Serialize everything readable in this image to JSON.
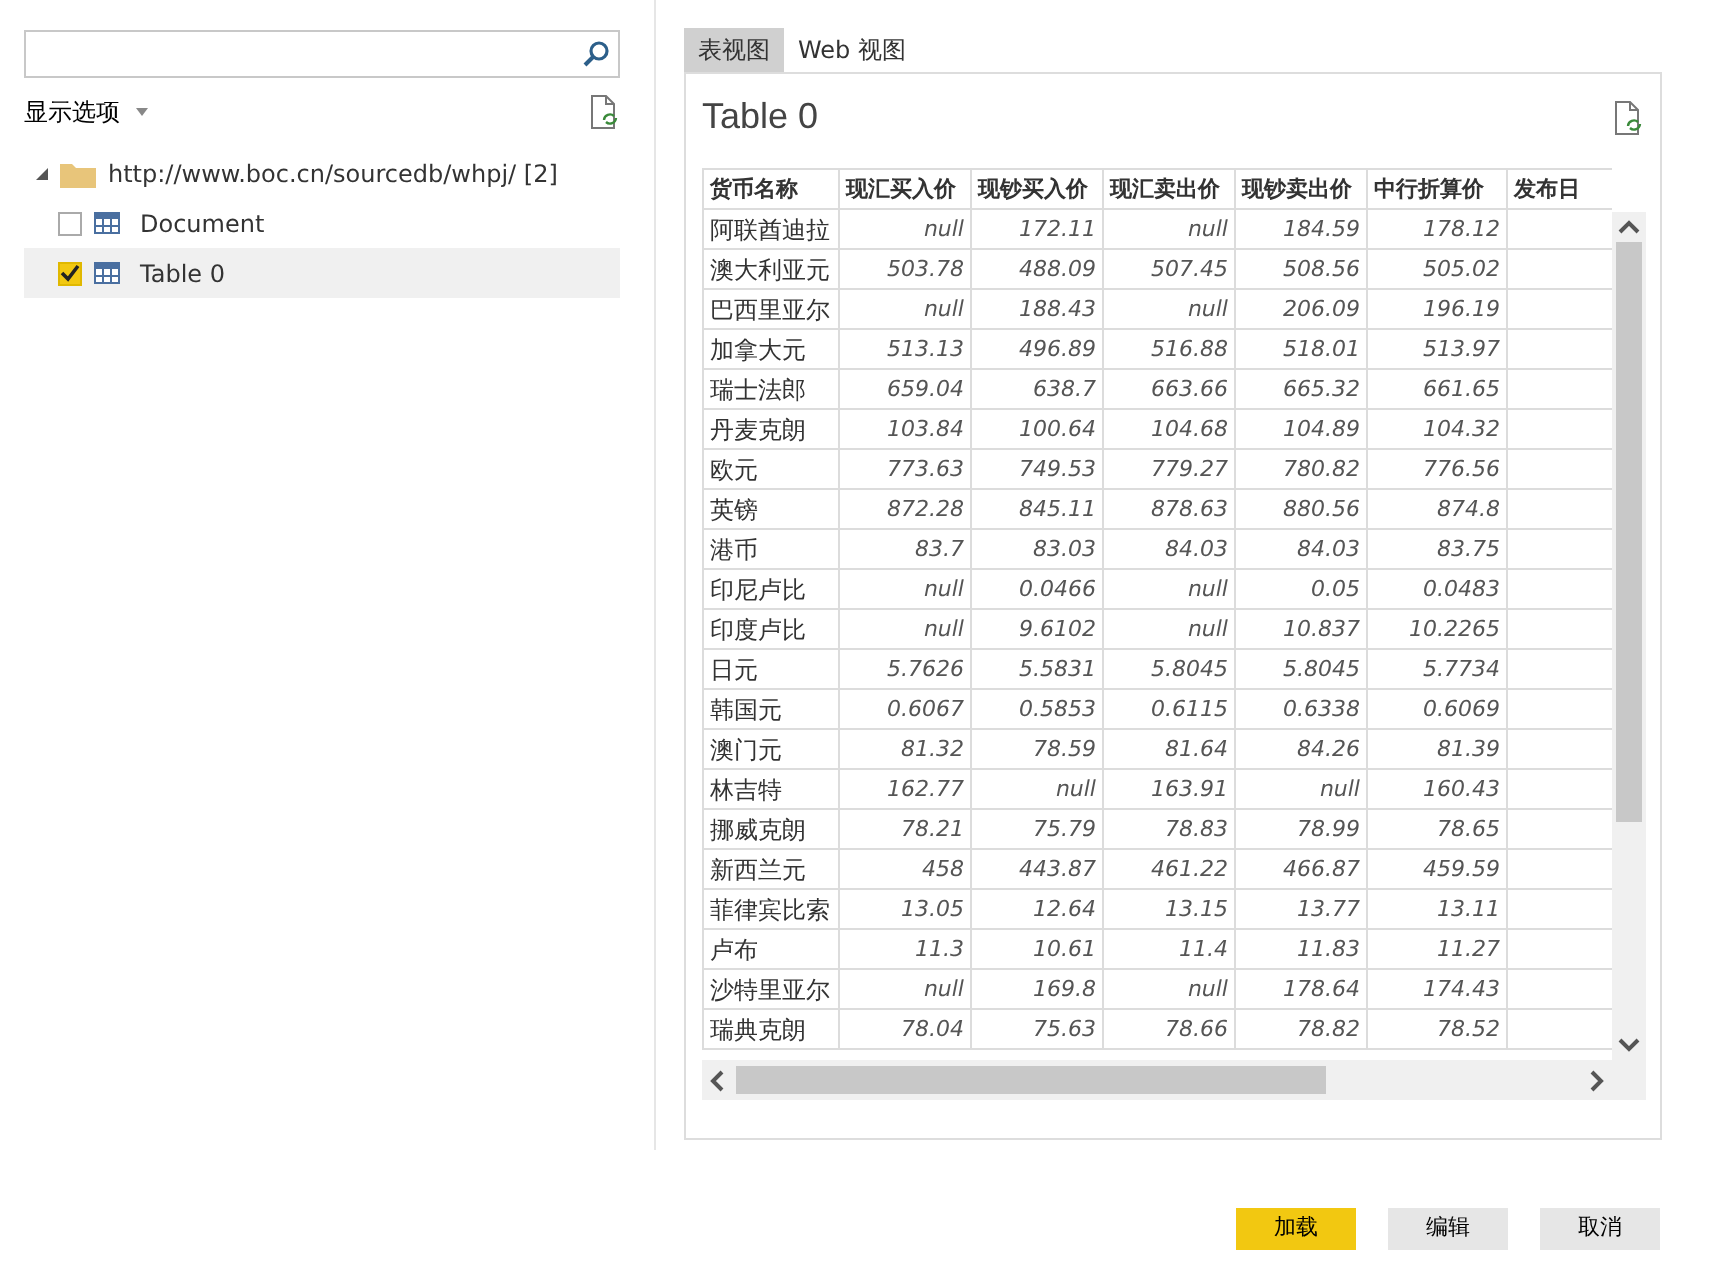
{
  "navigator": {
    "display_options": "显示选项",
    "tree": [
      {
        "label": "http://www.boc.cn/sourcedb/whpj/ [2]",
        "expanded": true,
        "children": [
          {
            "label": "Document",
            "checked": false,
            "selected": false
          },
          {
            "label": "Table 0",
            "checked": true,
            "selected": true
          }
        ]
      }
    ]
  },
  "tabs": [
    {
      "label": "表视图",
      "selected": true
    },
    {
      "label": "Web 视图",
      "selected": false
    }
  ],
  "preview": {
    "title": "Table 0",
    "columns": [
      "货币名称",
      "现汇买入价",
      "现钞买入价",
      "现汇卖出价",
      "现钞卖出价",
      "中行折算价",
      "发布日"
    ],
    "rows": [
      [
        "阿联酋迪拉",
        "null",
        "172.11",
        "null",
        "184.59",
        "178.12"
      ],
      [
        "澳大利亚元",
        "503.78",
        "488.09",
        "507.45",
        "508.56",
        "505.02"
      ],
      [
        "巴西里亚尔",
        "null",
        "188.43",
        "null",
        "206.09",
        "196.19"
      ],
      [
        "加拿大元",
        "513.13",
        "496.89",
        "516.88",
        "518.01",
        "513.97"
      ],
      [
        "瑞士法郎",
        "659.04",
        "638.7",
        "663.66",
        "665.32",
        "661.65"
      ],
      [
        "丹麦克朗",
        "103.84",
        "100.64",
        "104.68",
        "104.89",
        "104.32"
      ],
      [
        "欧元",
        "773.63",
        "749.53",
        "779.27",
        "780.82",
        "776.56"
      ],
      [
        "英镑",
        "872.28",
        "845.11",
        "878.63",
        "880.56",
        "874.8"
      ],
      [
        "港币",
        "83.7",
        "83.03",
        "84.03",
        "84.03",
        "83.75"
      ],
      [
        "印尼卢比",
        "null",
        "0.0466",
        "null",
        "0.05",
        "0.0483"
      ],
      [
        "印度卢比",
        "null",
        "9.6102",
        "null",
        "10.837",
        "10.2265"
      ],
      [
        "日元",
        "5.7626",
        "5.5831",
        "5.8045",
        "5.8045",
        "5.7734"
      ],
      [
        "韩国元",
        "0.6067",
        "0.5853",
        "0.6115",
        "0.6338",
        "0.6069"
      ],
      [
        "澳门元",
        "81.32",
        "78.59",
        "81.64",
        "84.26",
        "81.39"
      ],
      [
        "林吉特",
        "162.77",
        "null",
        "163.91",
        "null",
        "160.43"
      ],
      [
        "挪威克朗",
        "78.21",
        "75.79",
        "78.83",
        "78.99",
        "78.65"
      ],
      [
        "新西兰元",
        "458",
        "443.87",
        "461.22",
        "466.87",
        "459.59"
      ],
      [
        "菲律宾比索",
        "13.05",
        "12.64",
        "13.15",
        "13.77",
        "13.11"
      ],
      [
        "卢布",
        "11.3",
        "10.61",
        "11.4",
        "11.83",
        "11.27"
      ],
      [
        "沙特里亚尔",
        "null",
        "169.8",
        "null",
        "178.64",
        "174.43"
      ],
      [
        "瑞典克朗",
        "78.04",
        "75.63",
        "78.66",
        "78.82",
        "78.52"
      ]
    ]
  },
  "buttons": [
    {
      "label": "加载",
      "kind": "primary"
    },
    {
      "label": "编辑",
      "kind": "secondary"
    },
    {
      "label": "取消",
      "kind": "secondary"
    }
  ]
}
